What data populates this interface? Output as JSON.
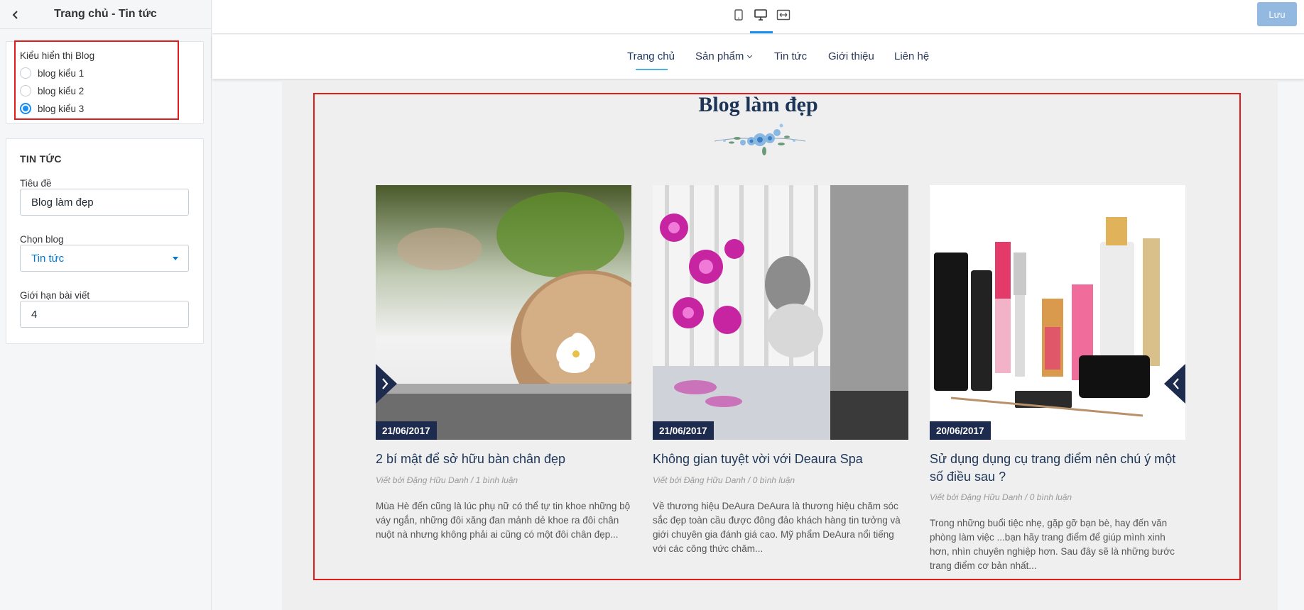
{
  "sidebar": {
    "title": "Trang chủ - Tin tức",
    "blog_style": {
      "label": "Kiểu hiển thị Blog",
      "options": [
        "blog kiểu 1",
        "blog kiểu 2",
        "blog kiểu 3"
      ],
      "selected": "blog kiểu 3"
    },
    "news": {
      "section_title": "TIN TỨC",
      "title_label": "Tiêu đề",
      "title_value": "Blog làm đẹp",
      "blog_label": "Chọn blog",
      "blog_value": "Tin tức",
      "limit_label": "Giới hạn bài viết",
      "limit_value": "4"
    }
  },
  "topbar": {
    "devices": [
      "mobile-icon",
      "desktop-icon",
      "fullwidth-icon"
    ],
    "active_device": "desktop-icon",
    "save_label": "Lưu"
  },
  "nav": {
    "items": [
      "Trang chủ",
      "Sản phẩm",
      "Tin tức",
      "Giới thiệu",
      "Liên hệ"
    ],
    "active": "Trang chủ"
  },
  "blog": {
    "title": "Blog làm đẹp",
    "posts": [
      {
        "date": "21/06/2017",
        "title": "2 bí mật để sở hữu bàn chân đẹp",
        "meta": "Viết bởi Đặng Hữu Danh / 1 bình luận",
        "excerpt": "Mùa Hè đến cũng là lúc phụ nữ có thể tự tin khoe những bộ váy ngắn, những đôi xăng đan mảnh dẻ khoe ra đôi chân nuột nà nhưng không phải ai cũng có một đôi chân đẹp..."
      },
      {
        "date": "21/06/2017",
        "title": "Không gian tuyệt vời với Deaura Spa",
        "meta": "Viết bởi Đặng Hữu Danh / 0 bình luận",
        "excerpt": "Về thương hiệu DeAura DeAura là thương hiệu chăm sóc sắc đẹp toàn cầu được đông đảo khách hàng tin tưởng và giới chuyên gia đánh giá cao. Mỹ phẩm DeAura nổi tiếng với các công thức chăm..."
      },
      {
        "date": "20/06/2017",
        "title": "Sử dụng dụng cụ trang điểm nên chú ý một số điều sau ?",
        "meta": "Viết bởi Đặng Hữu Danh / 0 bình luận",
        "excerpt": "Trong những buổi tiệc nhẹ, gặp gỡ bạn bè, hay đến văn phòng làm việc ...bạn hãy trang điểm để giúp mình xinh hơn, nhìn chuyên nghiệp hơn. Sau đây sẽ là những bước trang điểm cơ bản nhất..."
      }
    ]
  },
  "colors": {
    "accent": "#1b8ef2",
    "highlight": "#e21b1b",
    "heading": "#1d3557",
    "date_badge": "#1d2b4f"
  }
}
